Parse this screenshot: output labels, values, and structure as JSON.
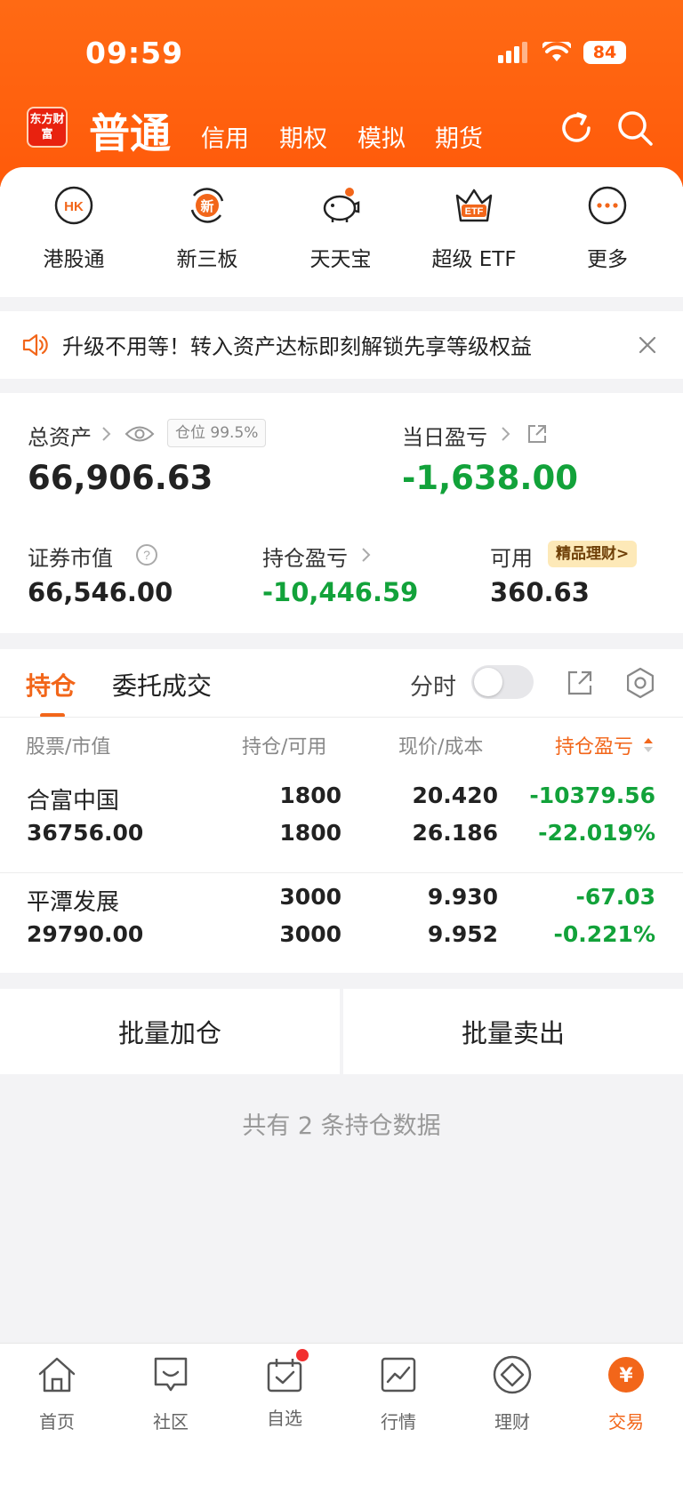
{
  "status_bar": {
    "time": "09:59",
    "battery": "84"
  },
  "header": {
    "logo_text": "东方财富",
    "tabs": [
      "普通",
      "信用",
      "期权",
      "模拟",
      "期货"
    ],
    "refresh_icon": "refresh-icon",
    "search_icon": "search-icon"
  },
  "quick_links": [
    {
      "label": "港股通",
      "icon": "hk-icon",
      "glyph": "HK"
    },
    {
      "label": "新三板",
      "icon": "new-board-icon",
      "glyph": "新"
    },
    {
      "label": "天天宝",
      "icon": "piggy-bank-icon",
      "glyph": ""
    },
    {
      "label": "超级 ETF",
      "icon": "etf-crown-icon",
      "glyph": "ETF"
    },
    {
      "label": "更多",
      "icon": "more-icon",
      "glyph": "···"
    }
  ],
  "notice": {
    "text": "升级不用等！转入资产达标即刻解锁先享等级权益",
    "icon": "speaker-icon",
    "close_icon": "close-icon"
  },
  "assets": {
    "total_label": "总资产",
    "total_value": "66,906.63",
    "position_ratio": "仓位 99.5%",
    "daily_label": "当日盈亏",
    "daily_value": "-1,638.00",
    "market_value_label": "证券市值",
    "market_value": "66,546.00",
    "holding_pl_label": "持仓盈亏",
    "holding_pl_value": "-10,446.59",
    "available_label": "可用",
    "available_value": "360.63",
    "wealth_badge": "精品理财>"
  },
  "holdings": {
    "tabs": [
      "持仓",
      "委托成交"
    ],
    "timeshare_label": "分时",
    "timeshare_on": false,
    "columns": [
      "股票/市值",
      "持仓/可用",
      "现价/成本",
      "持仓盈亏"
    ],
    "rows": [
      {
        "name": "合富中国",
        "market_value": "36756.00",
        "position": "1800",
        "available": "1800",
        "price": "20.420",
        "cost": "26.186",
        "pl": "-10379.56",
        "pl_pct": "-22.019%"
      },
      {
        "name": "平潭发展",
        "market_value": "29790.00",
        "position": "3000",
        "available": "3000",
        "price": "9.930",
        "cost": "9.952",
        "pl": "-67.03",
        "pl_pct": "-0.221%"
      }
    ]
  },
  "actions": {
    "batch_add": "批量加仓",
    "batch_sell": "批量卖出"
  },
  "summary_text": "共有 2 条持仓数据",
  "tabbar": [
    {
      "label": "首页",
      "icon": "home-icon"
    },
    {
      "label": "社区",
      "icon": "community-icon"
    },
    {
      "label": "自选",
      "icon": "watchlist-icon"
    },
    {
      "label": "行情",
      "icon": "market-icon"
    },
    {
      "label": "理财",
      "icon": "wealth-icon"
    },
    {
      "label": "交易",
      "icon": "trade-icon"
    }
  ],
  "colors": {
    "brand": "#ff5a0a",
    "accent": "#f2661a",
    "loss": "#12a23a"
  }
}
